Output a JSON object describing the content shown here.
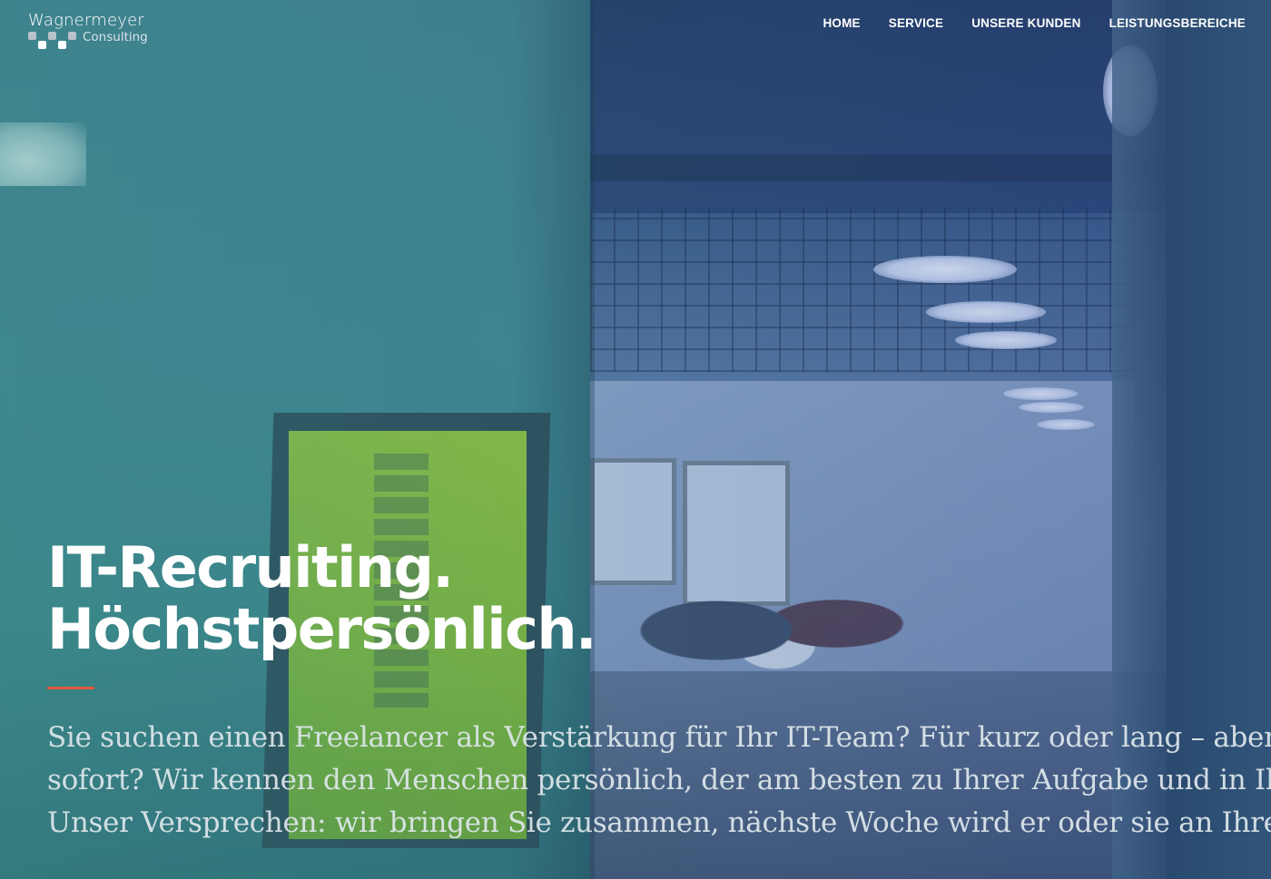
{
  "brand": {
    "name": "Wagnermeyer",
    "subtitle": "Consulting"
  },
  "nav": {
    "items": [
      {
        "label": "HOME"
      },
      {
        "label": "SERVICE"
      },
      {
        "label": "UNSERE KUNDEN"
      },
      {
        "label": "LEISTUNGSBEREICHE"
      }
    ]
  },
  "hero": {
    "title_line_1": "IT-Recruiting.",
    "title_line_2": "Höchstpersönlich.",
    "text_line_1": "Sie suchen einen Freelancer als Verstärkung für Ihr IT-Team? Für kurz oder lang – aber",
    "text_line_2": "sofort? Wir kennen den Menschen persönlich, der am besten zu Ihrer Aufgabe und in Ihr",
    "text_line_3": "Unser Versprechen: wir bringen Sie zusammen, nächste Woche wird er oder sie an Ihrem"
  },
  "colors": {
    "accent": "#e05a3c",
    "nav_text": "#ffffff"
  },
  "icons": {
    "logo_mark": "checker-squares-icon"
  }
}
